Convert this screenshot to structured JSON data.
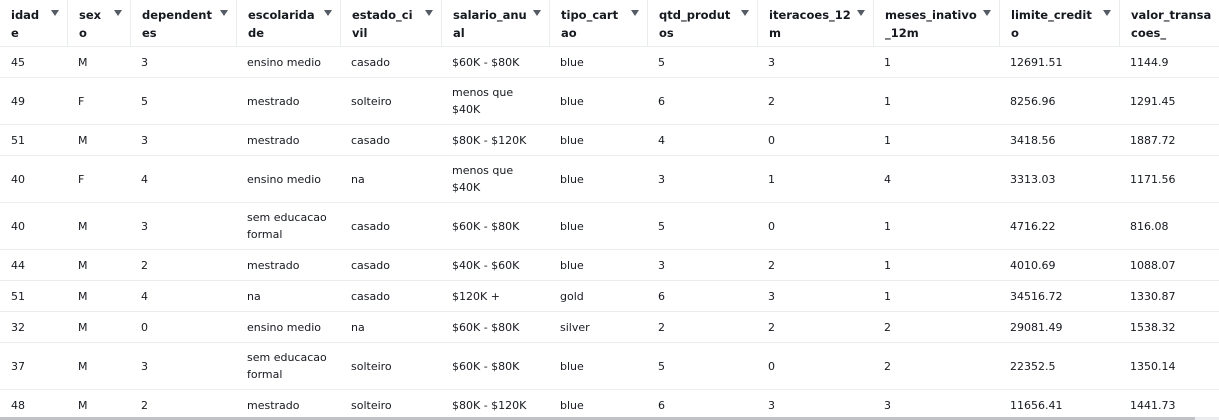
{
  "columns": [
    {
      "key": "idade",
      "label": "idade"
    },
    {
      "key": "sexo",
      "label": "sexo"
    },
    {
      "key": "dependentes",
      "label": "dependentes"
    },
    {
      "key": "escolaridade",
      "label": "escolaridade"
    },
    {
      "key": "estado_civil",
      "label": "estado_civil"
    },
    {
      "key": "salario_anual",
      "label": "salario_anual"
    },
    {
      "key": "tipo_cartao",
      "label": "tipo_cartao"
    },
    {
      "key": "qtd_produtos",
      "label": "qtd_produtos"
    },
    {
      "key": "iteracoes_12m",
      "label": "iteracoes_12m"
    },
    {
      "key": "meses_inativo_12m",
      "label": "meses_inativo_12m"
    },
    {
      "key": "limite_credito",
      "label": "limite_credito"
    },
    {
      "key": "valor_transacoes",
      "label": "valor_transacoes_"
    }
  ],
  "sort_icon": "caret-down-icon",
  "rows": [
    [
      "45",
      "M",
      "3",
      "ensino medio",
      "casado",
      "$60K - $80K",
      "blue",
      "5",
      "3",
      "1",
      "12691.51",
      "1144.9"
    ],
    [
      "49",
      "F",
      "5",
      "mestrado",
      "solteiro",
      "menos que $40K",
      "blue",
      "6",
      "2",
      "1",
      "8256.96",
      "1291.45"
    ],
    [
      "51",
      "M",
      "3",
      "mestrado",
      "casado",
      "$80K - $120K",
      "blue",
      "4",
      "0",
      "1",
      "3418.56",
      "1887.72"
    ],
    [
      "40",
      "F",
      "4",
      "ensino medio",
      "na",
      "menos que $40K",
      "blue",
      "3",
      "1",
      "4",
      "3313.03",
      "1171.56"
    ],
    [
      "40",
      "M",
      "3",
      "sem educacao formal",
      "casado",
      "$60K - $80K",
      "blue",
      "5",
      "0",
      "1",
      "4716.22",
      "816.08"
    ],
    [
      "44",
      "M",
      "2",
      "mestrado",
      "casado",
      "$40K - $60K",
      "blue",
      "3",
      "2",
      "1",
      "4010.69",
      "1088.07"
    ],
    [
      "51",
      "M",
      "4",
      "na",
      "casado",
      "$120K +",
      "gold",
      "6",
      "3",
      "1",
      "34516.72",
      "1330.87"
    ],
    [
      "32",
      "M",
      "0",
      "ensino medio",
      "na",
      "$60K - $80K",
      "silver",
      "2",
      "2",
      "2",
      "29081.49",
      "1538.32"
    ],
    [
      "37",
      "M",
      "3",
      "sem educacao formal",
      "solteiro",
      "$60K - $80K",
      "blue",
      "5",
      "0",
      "2",
      "22352.5",
      "1350.14"
    ],
    [
      "48",
      "M",
      "2",
      "mestrado",
      "solteiro",
      "$80K - $120K",
      "blue",
      "6",
      "3",
      "3",
      "11656.41",
      "1441.73"
    ]
  ]
}
